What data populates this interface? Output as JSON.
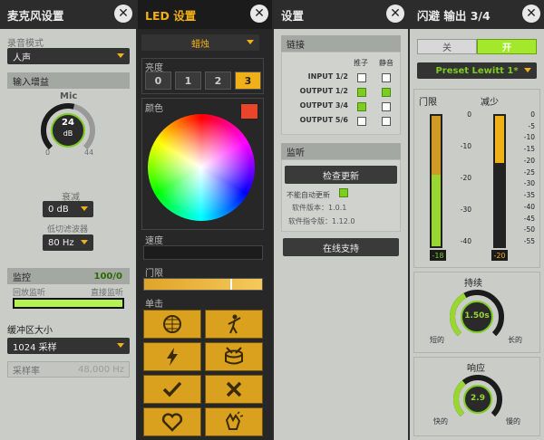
{
  "panel1": {
    "title": "麦克风设置",
    "record_mode_label": "录音模式",
    "record_mode_value": "人声",
    "input_gain_header": "输入增益",
    "mic_label": "Mic",
    "knob_value": "24",
    "knob_unit": "dB",
    "knob_min": "0",
    "knob_max": "44",
    "attenuation_label": "衰减",
    "attenuation_value": "0 dB",
    "lowcut_label": "低切滤波器",
    "lowcut_value": "80 Hz",
    "monitor_label": "监控",
    "monitor_value": "100/0",
    "playback_label": "回放监听",
    "direct_label": "直接监听",
    "buffer_label": "缓冲区大小",
    "buffer_value": "1024 采样",
    "samplerate_label": "采样率",
    "samplerate_value": "48,000 Hz"
  },
  "panel2": {
    "title": "LED 设置",
    "mode_value": "蜡烛",
    "brightness_label": "亮度",
    "brightness_options": [
      "0",
      "1",
      "2",
      "3"
    ],
    "brightness_selected": "3",
    "color_label": "颜色",
    "selected_color": "#e8452b",
    "speed_label": "速度",
    "threshold_label": "门限",
    "single_label": "单击",
    "tiles": [
      "disco-ball-icon",
      "dancer-icon",
      "lightning-icon",
      "drum-icon",
      "checkmark-icon",
      "cross-icon",
      "heart-icon",
      "clap-icon"
    ]
  },
  "panel3": {
    "title": "设置",
    "routing_header": "链接",
    "col_push": "推子",
    "col_mute": "静音",
    "rows": [
      {
        "label": "INPUT 1/2",
        "push": false,
        "mute": false
      },
      {
        "label": "OUTPUT 1/2",
        "push": true,
        "mute": true
      },
      {
        "label": "OUTPUT 3/4",
        "push": true,
        "mute": false
      },
      {
        "label": "OUTPUT 5/6",
        "push": false,
        "mute": false
      }
    ],
    "monitor_header": "监听",
    "check_update_button": "检查更新",
    "auto_check_label": "不能自动更新",
    "software_version": "软件版本：1.0.1",
    "firmware_version": "软件指令版：1.12.0",
    "online_support_button": "在线支持"
  },
  "panel4": {
    "title": "闪避 输出 3/4",
    "toggle_off": "关",
    "toggle_on": "开",
    "preset_value": "Preset Lewitt 1*",
    "threshold_label": "门限",
    "reduction_label": "减少",
    "threshold_ticks": [
      "0",
      "-10",
      "-20",
      "-30",
      "-40"
    ],
    "reduction_ticks": [
      "0",
      "-5",
      "-10",
      "-15",
      "-20",
      "-25",
      "-30",
      "-35",
      "-40",
      "-45",
      "-50",
      "-55"
    ],
    "threshold_value": "-18",
    "reduction_value": "-20",
    "threshold_level": 0.45,
    "reduction_level": 0.36,
    "sustain_label": "持续",
    "sustain_value": "1.50s",
    "sustain_short": "短的",
    "sustain_long": "长的",
    "response_label": "响应",
    "response_value": "2.9",
    "response_fast": "快的",
    "response_slow": "慢的"
  }
}
